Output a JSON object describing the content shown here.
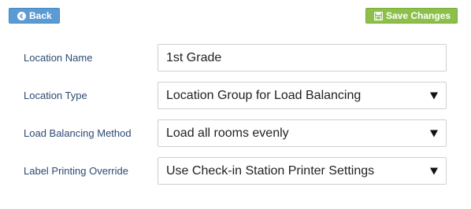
{
  "toolbar": {
    "back_label": "Back",
    "back_icon": "back-circle-icon",
    "save_label": "Save Changes",
    "save_icon": "floppy-disk-icon"
  },
  "form": {
    "location_name": {
      "label": "Location Name",
      "value": "1st Grade"
    },
    "location_type": {
      "label": "Location Type",
      "value": "Location Group for Load Balancing"
    },
    "load_balancing_method": {
      "label": "Load Balancing Method",
      "value": "Load all rooms evenly"
    },
    "label_printing_override": {
      "label": "Label Printing Override",
      "value": "Use Check-in Station Printer Settings"
    }
  },
  "colors": {
    "back_button": "#5b9bd5",
    "save_button": "#8dc04a",
    "label_text": "#2c4a72"
  }
}
